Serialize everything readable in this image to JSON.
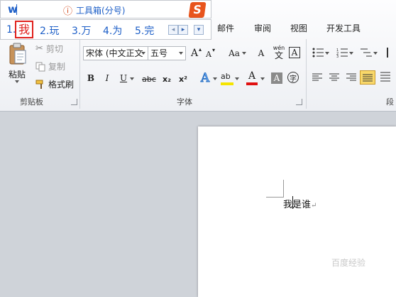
{
  "ime": {
    "typed_text": "w",
    "toolbox_icon_glyph": "ⓘ",
    "toolbox_label": "工具箱(分号)",
    "logo_glyph": "S",
    "candidates": [
      {
        "num": "1.",
        "text": "我"
      },
      {
        "num": "2.",
        "text": "玩"
      },
      {
        "num": "3.",
        "text": "万"
      },
      {
        "num": "4.",
        "text": "为"
      },
      {
        "num": "5.",
        "text": "完"
      }
    ],
    "prev_glyph": "◂",
    "next_glyph": "▸",
    "more_glyph": "▾"
  },
  "tabs": [
    "邮件",
    "审阅",
    "视图",
    "开发工具"
  ],
  "clipboard": {
    "paste_label": "粘贴",
    "cut_label": "剪切",
    "copy_label": "复制",
    "format_painter_label": "格式刷",
    "group_label": "剪贴板"
  },
  "font": {
    "font_name": "宋体 (中文正文)",
    "font_size": "五号",
    "grow_label": "A",
    "shrink_label": "A",
    "change_case_label": "Aa",
    "phonetic_label": "文",
    "phonetic_top": "wén",
    "border_label": "A",
    "bold": "B",
    "italic": "I",
    "underline": "U",
    "strike": "abc",
    "subscript": "x₂",
    "superscript": "x²",
    "effect": "A",
    "highlight": "ab",
    "color": "A",
    "shading": "A",
    "enclose": "字",
    "group_label": "字体"
  },
  "paragraph": {
    "group_label_partial": "段"
  },
  "document": {
    "text": "我是谁",
    "paragraph_mark": "↵"
  },
  "watermark": {
    "text": "百度经验"
  },
  "colors": {
    "ime_red": "#e0201c",
    "ime_blue": "#1c5ec7",
    "font_color_bar": "#e01010",
    "highlight_bar": "#f5e400",
    "selected_align": "#f9d86a"
  },
  "icons": [
    "clipboard-icon",
    "scissors-icon",
    "copy-icon",
    "format-painter-icon",
    "bullets-icon",
    "numbering-icon",
    "multilevel-icon",
    "align-left-icon",
    "align-center-icon",
    "align-right-icon",
    "justify-icon"
  ]
}
